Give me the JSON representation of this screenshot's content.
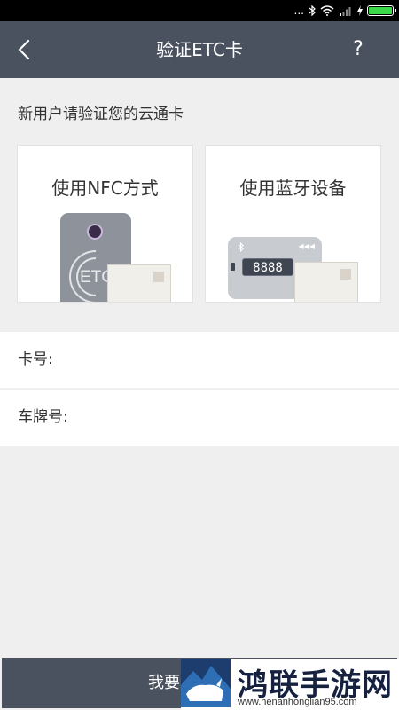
{
  "status_bar": {
    "signal_text": "...",
    "battery_level": 1.0,
    "battery_color": "#3bd84a"
  },
  "nav": {
    "back_icon": "chevron-left-icon",
    "title": "验证ETC卡",
    "help_label": "?"
  },
  "intro_text": "新用户请验证您的云通卡",
  "options": {
    "nfc": {
      "label": "使用NFC方式",
      "illustration_text": "ETC"
    },
    "bluetooth": {
      "label": "使用蓝牙设备",
      "display_text": "8888"
    }
  },
  "form": {
    "card_number": {
      "label": "卡号:",
      "value": ""
    },
    "plate_number": {
      "label": "车牌号:",
      "value": ""
    }
  },
  "submit_label": "我要",
  "watermark": {
    "title": "鸿联手游网",
    "url": "www.henanhonglian95.com"
  },
  "colors": {
    "nav_bg": "#4a525f",
    "page_bg": "#f0eff0",
    "accent_battery": "#3bd84a"
  }
}
